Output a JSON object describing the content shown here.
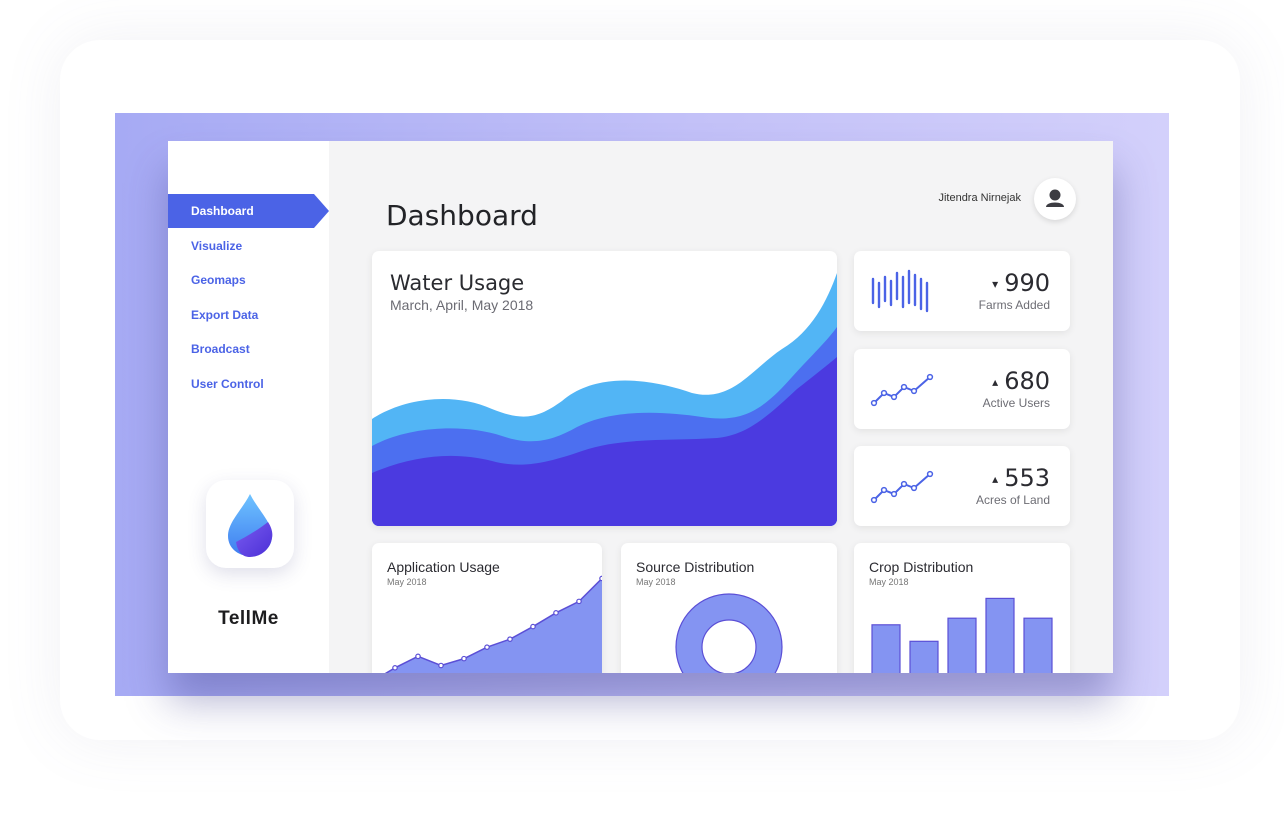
{
  "app": {
    "brand": "TellMe"
  },
  "sidebar": {
    "items": [
      {
        "label": "Dashboard",
        "active": true
      },
      {
        "label": "Visualize",
        "active": false
      },
      {
        "label": "Geomaps",
        "active": false
      },
      {
        "label": "Export Data",
        "active": false
      },
      {
        "label": "Broadcast",
        "active": false
      },
      {
        "label": "User Control",
        "active": false
      }
    ]
  },
  "header": {
    "title": "Dashboard",
    "user_name": "Jitendra Nirnejak",
    "avatar_icon": "user-icon"
  },
  "water_usage": {
    "title": "Water Usage",
    "subtitle": "March, April, May 2018",
    "colors": [
      "#52b5f5",
      "#4c6ff0",
      "#4b3ae0"
    ]
  },
  "stats": [
    {
      "value": "990",
      "label": "Farms Added",
      "trend": "down",
      "arrow": "▾",
      "icon": "bar-pulse-icon"
    },
    {
      "value": "680",
      "label": "Active Users",
      "trend": "up",
      "arrow": "▴",
      "icon": "line-trend-icon"
    },
    {
      "value": "553",
      "label": "Acres of Land",
      "trend": "up",
      "arrow": "▴",
      "icon": "line-trend-icon"
    }
  ],
  "cards": {
    "application_usage": {
      "title": "Application Usage",
      "subtitle": "May 2018"
    },
    "source_distribution": {
      "title": "Source Distribution",
      "subtitle": "May 2018"
    },
    "crop_distribution": {
      "title": "Crop Distribution",
      "subtitle": "May 2018"
    }
  },
  "colors": {
    "accent": "#4b63e6",
    "chart_fill": "#8494f2",
    "chart_line": "#5b4fd6"
  },
  "chart_data": [
    {
      "type": "area",
      "title": "Application Usage",
      "subtitle": "May 2018",
      "x": [
        1,
        2,
        3,
        4,
        5,
        6,
        7,
        8,
        9,
        10,
        11
      ],
      "values": [
        10,
        22,
        32,
        24,
        30,
        40,
        47,
        58,
        70,
        80,
        100
      ],
      "ylim": [
        0,
        110
      ]
    },
    {
      "type": "pie",
      "title": "Source Distribution",
      "subtitle": "May 2018",
      "donut": true,
      "values": [
        100
      ]
    },
    {
      "type": "bar",
      "title": "Crop Distribution",
      "subtitle": "May 2018",
      "values": [
        62,
        47,
        68,
        86,
        68
      ],
      "ylim": [
        0,
        100
      ]
    }
  ]
}
